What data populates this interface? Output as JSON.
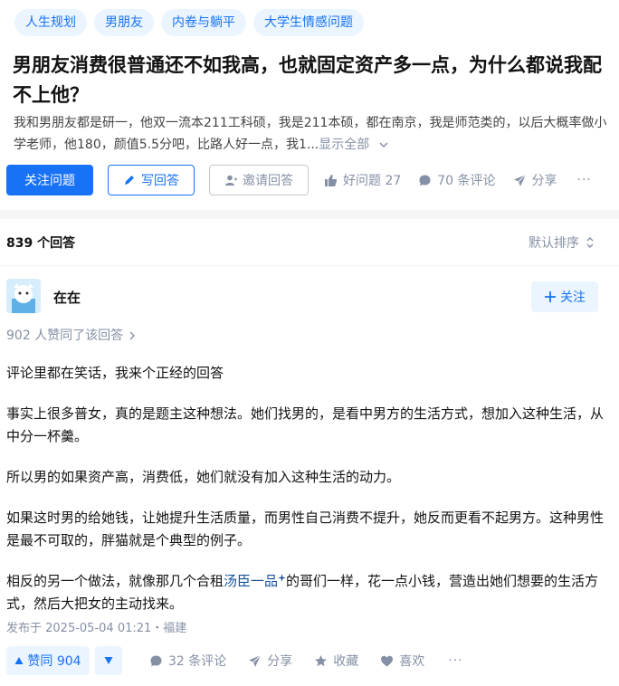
{
  "question": {
    "topics": [
      "人生规划",
      "男朋友",
      "内卷与躺平",
      "大学生情感问题"
    ],
    "title": "男朋友消费很普通还不如我高，也就固定资产多一点，为什么都说我配不上他？",
    "desc": "我和男朋友都是研一，他双一流本211工科硕，我是211本硕，都在南京，我是师范类的，以后大概率做小学老师，他180，颜值5.5分吧，比路人好一点，我1...",
    "show_all": "显示全部",
    "actions": {
      "follow": "关注问题",
      "write": "写回答",
      "invite": "邀请回答",
      "good_question": "好问题 27",
      "comments": "70 条评论",
      "share": "分享",
      "more": "···"
    }
  },
  "answers": {
    "count": "839 个回答",
    "sort": "默认排序",
    "author": {
      "name": "在在",
      "follow": "关注"
    },
    "approved": "902 人赞同了该回答",
    "paragraphs": [
      "评论里都在笑话，我来个正经的回答",
      "事实上很多普女，真的是题主这种想法。她们找男的，是看中男方的生活方式，想加入这种生活，从中分一杯羹。",
      "所以男的如果资产高，消费低，她们就没有加入这种生活的动力。",
      "如果这时男的给她钱，让她提升生活质量，而男性自己消费不提升，她反而更看不起男方。这种男性是最不可取的，胖猫就是个典型的例子。"
    ],
    "last_para_before": "相反的另一个做法，就像那几个合租",
    "last_para_link": "汤臣一品",
    "last_para_after": "的哥们一样，花一点小钱，营造出她们想要的生活方式，然后大把女的主动找来。",
    "published": "发布于 2025-05-04 01:21・福建",
    "bar": {
      "vote": "赞同 904",
      "comments": "32 条评论",
      "share": "分享",
      "collect": "收藏",
      "like": "喜欢",
      "more": "···"
    }
  }
}
